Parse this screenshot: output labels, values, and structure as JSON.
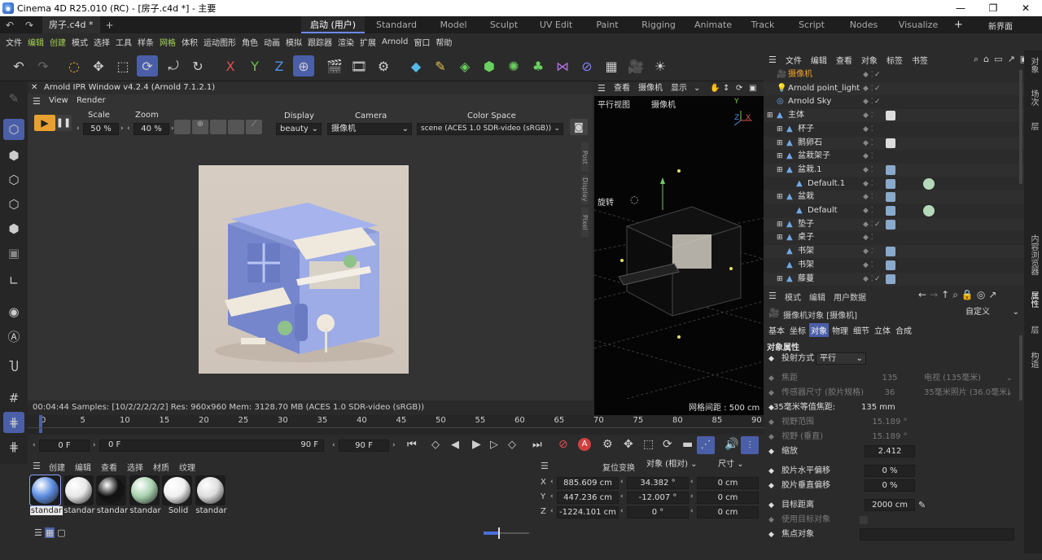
{
  "window": {
    "title": "Cinema 4D R25.010 (RC) - [房子.c4d *] - 主要",
    "minimize": "—",
    "restore": "❐",
    "close": "✕"
  },
  "tabs": {
    "doc_tab": "房子.c4d *",
    "add": "+",
    "new_interface": "新界面"
  },
  "layouts": [
    {
      "label": "启动 (用户)",
      "active": true
    },
    {
      "label": "Standard"
    },
    {
      "label": "Model"
    },
    {
      "label": "Sculpt"
    },
    {
      "label": "UV Edit"
    },
    {
      "label": "Paint"
    },
    {
      "label": "Rigging"
    },
    {
      "label": "Animate"
    },
    {
      "label": "Track"
    },
    {
      "label": "Script"
    },
    {
      "label": "Nodes"
    },
    {
      "label": "Visualize"
    }
  ],
  "menu": [
    "文件",
    "编辑",
    "创建",
    "模式",
    "选择",
    "工具",
    "样条",
    "网格",
    "体积",
    "运动图形",
    "角色",
    "动画",
    "模拟",
    "跟踪器",
    "渲染",
    "扩展",
    "Arnold",
    "窗口",
    "帮助"
  ],
  "ipr": {
    "title": "Arnold IPR Window v4.2.4 (Arnold 7.1.2.1)",
    "menu_view": "View",
    "menu_render": "Render",
    "scale_label": "Scale",
    "scale_value": "50 %",
    "zoom_label": "Zoom",
    "zoom_value": "40 %",
    "display_label": "Display",
    "display_value": "beauty",
    "camera_label": "Camera",
    "camera_value": "摄像机",
    "colorspace_label": "Color Space",
    "colorspace_value": "scene (ACES 1.0 SDR-video (sRGB))",
    "side_tabs": [
      "Post",
      "Display",
      "Pixel"
    ],
    "status": "00:04:44  Samples: [10/2/2/2/2/2]  Res: 960x960  Mem: 3128.70 MB  (ACES 1.0 SDR-video (sRGB))"
  },
  "viewport": {
    "menu": [
      "查看",
      "摄像机",
      "显示"
    ],
    "view_name": "平行视图",
    "camera_name": "摄像机",
    "rotate_label": "旋转",
    "grid_info": "网格间距 : 500 cm",
    "axis_y": "Y",
    "axis_x": "X",
    "axis_z": "Z"
  },
  "timeline": {
    "ticks": [
      "0",
      "5",
      "10",
      "15",
      "20",
      "25",
      "30",
      "35",
      "40",
      "45",
      "50",
      "55",
      "60",
      "65",
      "70",
      "75",
      "80",
      "85",
      "90"
    ],
    "start": "0 F",
    "current": "0 F",
    "end_left": "90 F",
    "end_right": "90 F"
  },
  "materials": {
    "menu": [
      "创建",
      "编辑",
      "查看",
      "选择",
      "材质",
      "纹理"
    ],
    "items": [
      {
        "label": "standar",
        "color": "#5d8de0"
      },
      {
        "label": "standar",
        "color": "#e8e8e8"
      },
      {
        "label": "standar",
        "color": "#111111"
      },
      {
        "label": "standar",
        "color": "#a9d3b0"
      },
      {
        "label": "Solid",
        "color": "#f0f0f0"
      },
      {
        "label": "standar",
        "color": "#dedede"
      }
    ]
  },
  "coords": {
    "reset": "复位变换",
    "mode": "对象 (相对)",
    "size": "尺寸",
    "rows": [
      {
        "axis": "X",
        "pos": "885.609 cm",
        "rot": "34.382 °",
        "size": "0 cm"
      },
      {
        "axis": "Y",
        "pos": "447.236 cm",
        "rot": "-12.007 °",
        "size": "0 cm"
      },
      {
        "axis": "Z",
        "pos": "-1224.101 cm",
        "rot": "0 °",
        "size": "0 cm"
      }
    ]
  },
  "objects": {
    "menu": [
      "文件",
      "编辑",
      "查看",
      "对象",
      "标签",
      "书签"
    ],
    "rows": [
      {
        "name": "摄像机",
        "indent": 0,
        "color": "#f0a030",
        "selected": true
      },
      {
        "name": "Arnold point_light",
        "indent": 0,
        "color": "#dddddd"
      },
      {
        "name": "Arnold Sky",
        "indent": 0,
        "color": "#dddddd"
      },
      {
        "name": "主体",
        "indent": 0,
        "color": "#dddddd"
      },
      {
        "name": "杯子",
        "indent": 1,
        "color": "#dddddd"
      },
      {
        "name": "鹅卵石",
        "indent": 1,
        "color": "#dddddd"
      },
      {
        "name": "盆栽架子",
        "indent": 1,
        "color": "#dddddd"
      },
      {
        "name": "盆栽.1",
        "indent": 1,
        "color": "#dddddd"
      },
      {
        "name": "Default.1",
        "indent": 2,
        "color": "#dddddd"
      },
      {
        "name": "盆栽",
        "indent": 1,
        "color": "#dddddd"
      },
      {
        "name": "Default",
        "indent": 2,
        "color": "#dddddd"
      },
      {
        "name": "垫子",
        "indent": 1,
        "color": "#dddddd"
      },
      {
        "name": "桌子",
        "indent": 1,
        "color": "#dddddd"
      },
      {
        "name": "书架",
        "indent": 1,
        "color": "#dddddd"
      },
      {
        "name": "书架",
        "indent": 1,
        "color": "#dddddd"
      },
      {
        "name": "藤蔓",
        "indent": 1,
        "color": "#dddddd"
      }
    ]
  },
  "attributes": {
    "menu": [
      "模式",
      "编辑",
      "用户数据"
    ],
    "object_title": "摄像机对象 [摄像机]",
    "preset": "自定义",
    "tabs": [
      {
        "label": "基本"
      },
      {
        "label": "坐标"
      },
      {
        "label": "对象",
        "active": true
      },
      {
        "label": "物理"
      },
      {
        "label": "细节"
      },
      {
        "label": "立体"
      },
      {
        "label": "合成"
      }
    ],
    "section": "对象属性",
    "rows": [
      {
        "label": "投射方式",
        "value": "平行",
        "dim": false
      },
      {
        "label": "焦距",
        "value": "135",
        "extra": "电视 (135毫米)",
        "dim": true
      },
      {
        "label": "传感器尺寸 (胶片规格)",
        "value": "36",
        "extra": "35毫米照片 (36.0毫米)",
        "dim": true
      },
      {
        "label": "35毫米等值焦距:",
        "value": "135 mm",
        "dim": false
      },
      {
        "label": "视野范围",
        "value": "15.189 °",
        "dim": true
      },
      {
        "label": "视野 (垂直)",
        "value": "15.189 °",
        "dim": true
      },
      {
        "label": "缩放",
        "value": "2.412",
        "dim": false
      },
      {
        "label": "胶片水平偏移",
        "value": "0 %",
        "dim": false
      },
      {
        "label": "胶片垂直偏移",
        "value": "0 %",
        "dim": false
      },
      {
        "label": "目标距离",
        "value": "2000 cm",
        "dim": false
      },
      {
        "label": "使用目标对象",
        "value": "",
        "dim": true
      },
      {
        "label": "焦点对象",
        "value": "",
        "dim": false
      }
    ]
  },
  "right_strip": [
    "对象",
    "场次",
    "层",
    "内容浏览器",
    "属性",
    "层",
    "构造"
  ],
  "colors": {
    "accent": "#4b5fa8",
    "highlight": "#a4d455",
    "camera_orange": "#f0a030"
  }
}
